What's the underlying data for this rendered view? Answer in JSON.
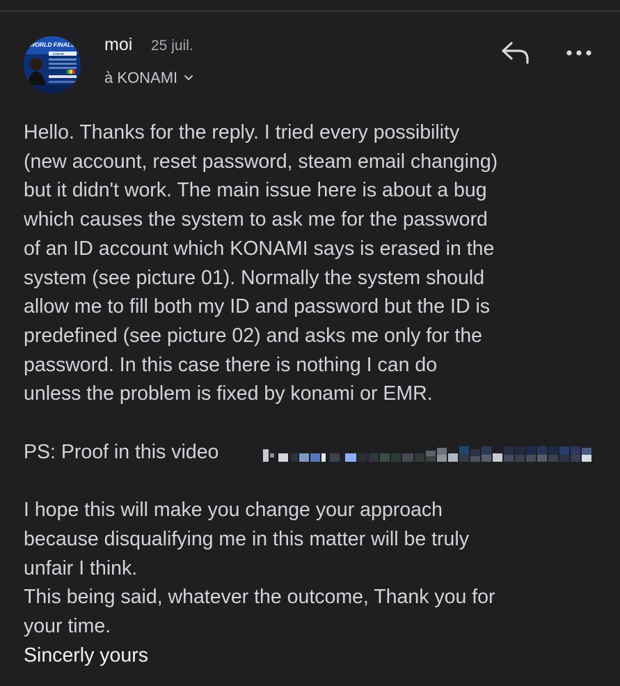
{
  "header": {
    "sender": "moi",
    "date": "25 juil.",
    "recipient": "à KONAMI"
  },
  "avatar": {
    "banner_text": "WORLD FINALS",
    "badge_text": "STEAM"
  },
  "icons": {
    "reply": "reply-arrow-icon",
    "more": "more-dots-icon",
    "recipient_toggle": "chevron-down-icon"
  },
  "message": {
    "para1": [
      "Hello. Thanks for the reply. I tried every possibility",
      "(new account, reset password, steam email changing)",
      "but it didn't work. The main issue here is about a bug",
      "which causes the system to ask me for the password",
      "of an ID account which KONAMI says is erased in the",
      "system (see picture 01). Normally the system should",
      "allow me to fill both my ID and password but the ID is",
      "predefined (see picture 02) and asks me only for the",
      "password. In this case there is nothing I can do",
      "unless the problem is fixed by konami or EMR."
    ],
    "ps": "PS: Proof in this video",
    "para3": [
      "I hope this will make you change your approach",
      "because disqualifying me in this matter will be truly",
      "unfair I think.",
      "This being said, whatever the outcome, Thank you for",
      "your time."
    ],
    "signoff": "Sincerly yours"
  },
  "colors": {
    "background": "#1f1f22",
    "text": "#d4d4d8",
    "muted": "#a9a9ae"
  }
}
